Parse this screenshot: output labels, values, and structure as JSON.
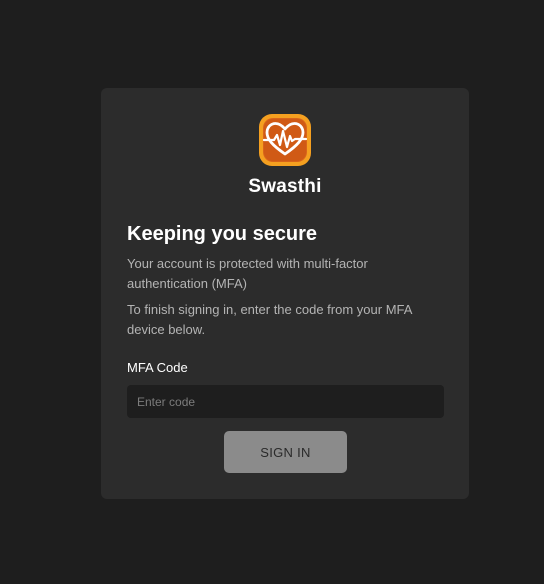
{
  "app": {
    "name": "Swasthi",
    "logo_icon": "heart-pulse-icon",
    "logo_colors": {
      "outer": "#f59a23",
      "inner": "#d85d10",
      "glyph": "#ffffff"
    }
  },
  "mfa": {
    "heading": "Keeping you secure",
    "description_1": "Your account is protected with multi-factor authentication (MFA)",
    "description_2": "To finish signing in, enter the code from your MFA device below.",
    "code_label": "MFA Code",
    "code_value": "",
    "code_placeholder": "Enter code",
    "sign_in_label": "SIGN IN"
  },
  "colors": {
    "page_background": "#1e1e1e",
    "card_background": "#2c2c2c",
    "input_background": "#1e1e1e",
    "button_background": "#8b8b8b",
    "button_text": "#2a2a2a"
  }
}
